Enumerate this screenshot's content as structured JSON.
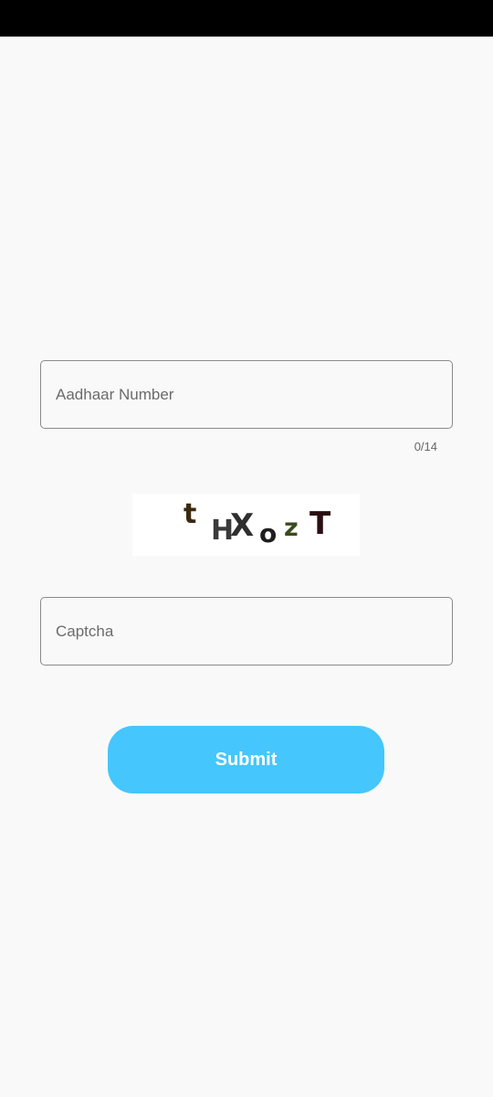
{
  "aadhaar": {
    "placeholder": "Aadhaar Number",
    "value": "",
    "counter": "0/14"
  },
  "captcha_image": {
    "text": "tHXozT",
    "glyphs": [
      {
        "char": "t",
        "color": "#3a2a10"
      },
      {
        "char": "H",
        "color": "#3a3a3a"
      },
      {
        "char": "X",
        "color": "#2f2f2f"
      },
      {
        "char": "o",
        "color": "#1f1f1f"
      },
      {
        "char": "z",
        "color": "#3b4a1e"
      },
      {
        "char": "T",
        "color": "#2a0f12"
      }
    ]
  },
  "captcha_input": {
    "placeholder": "Captcha",
    "value": ""
  },
  "submit": {
    "label": "Submit",
    "color": "#45c6fd"
  },
  "colors": {
    "background": "#f9f9f9",
    "status_bar": "#000000",
    "field_border": "#8a8a8a"
  }
}
